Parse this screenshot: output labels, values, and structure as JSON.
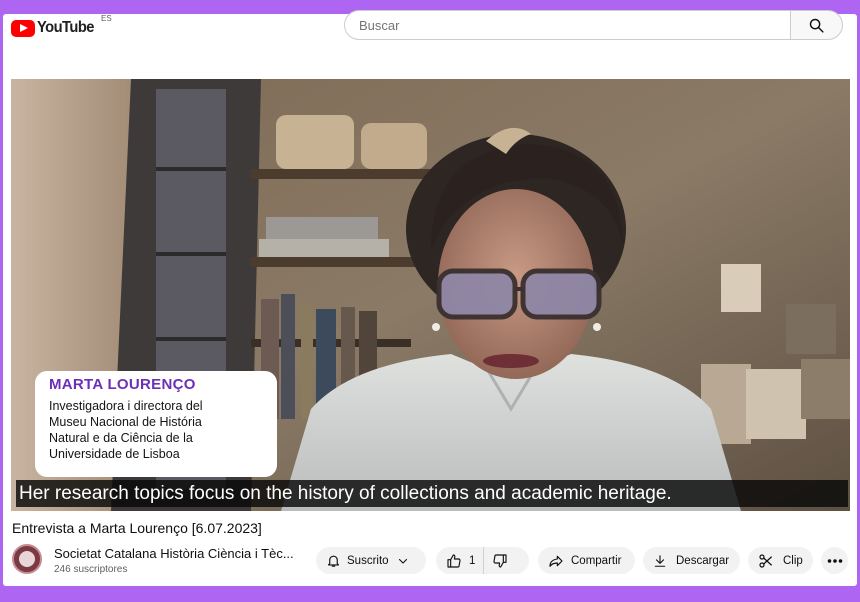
{
  "header": {
    "logo_text": "YouTube",
    "region_code": "ES",
    "search_placeholder": "Buscar",
    "search_icon": "search-icon"
  },
  "video": {
    "lower_third": {
      "name": "MARTA LOURENÇO",
      "role_lines": [
        "Investigadora i directora del",
        "Museu Nacional de História",
        "Natural e da Ciência de la",
        "Universidade de Lisboa"
      ]
    },
    "subtitle": "Her research topics focus on the history of collections and academic heritage."
  },
  "details": {
    "title": "Entrevista a Marta Lourenço [6.07.2023]",
    "channel_name": "Societat Catalana Història Ciència i Tèc...",
    "subscribers": "246 suscriptores"
  },
  "actions": {
    "subscribed_label": "Suscrito",
    "like_count": "1",
    "share_label": "Compartir",
    "download_label": "Descargar",
    "clip_label": "Clip",
    "icons": [
      "bell-icon",
      "chevron-down-icon",
      "thumbs-up-icon",
      "thumbs-down-icon",
      "share-icon",
      "download-icon",
      "scissors-icon",
      "more-icon"
    ]
  },
  "colors": {
    "page_border": "#ae66f2",
    "brand_red": "#ff0000",
    "lower_third_name": "#6d2fb6",
    "pill_bg": "#f2f2f2"
  }
}
